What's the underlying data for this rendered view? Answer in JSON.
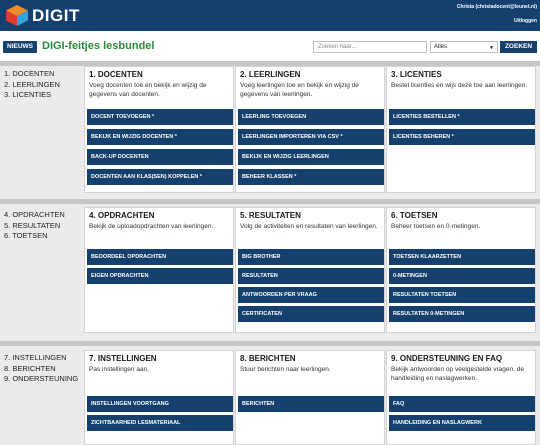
{
  "header": {
    "brand": "DIGIT",
    "user": "Christa (christadocent@leunet.nl)",
    "logout": "Uitloggen"
  },
  "nav": {
    "news_button": "NIEUWS",
    "title": "DIGI-feitjes lesbundel",
    "search_placeholder": "Zoeken naar...",
    "search_filter": "Alles",
    "search_button": "ZOEKEN"
  },
  "colors": {
    "primary": "#15406e",
    "title_green": "#2b8a3e",
    "band_bg": "#ebebeb",
    "separator": "#c6c6c6"
  },
  "sections": [
    {
      "list": [
        "1. DOCENTEN",
        "2. LEERLINGEN",
        "3. LICENTIES"
      ],
      "cards": [
        {
          "title": "1. DOCENTEN",
          "desc": "Voeg docenten toe en bekijk en wijzig de gegevens van docenten.",
          "buttons": [
            "DOCENT TOEVOEGEN *",
            "BEKIJK EN WIJZIG DOCENTEN *",
            "BACK-UP DOCENTEN",
            "DOCENTEN AAN KLAS(SEN) KOPPELEN *"
          ]
        },
        {
          "title": "2. LEERLINGEN",
          "desc": "Voeg leerlingen toe en bekijk en wijzig de gegevens van leerlingen.",
          "buttons": [
            "LEERLING TOEVOEGEN",
            "LEERLINGEN IMPORTEREN VIA CSV *",
            "BEKIJK EN WIJZIG LEERLINGEN",
            "BEHEER KLASSEN *"
          ]
        },
        {
          "title": "3. LICENTIES",
          "desc": "Bestel licenties en wijs deze toe aan leerlingen.",
          "buttons": [
            "LICENTIES BESTELLEN *",
            "LICENTIES BEHEREN *"
          ]
        }
      ]
    },
    {
      "list": [
        "4. OPDRACHTEN",
        "5. RESULTATEN",
        "6. TOETSEN"
      ],
      "cards": [
        {
          "title": "4. OPDRACHTEN",
          "desc": "Bekijk de uploadopdrachten van leerlingen.",
          "buttons": [
            "BEOORDEEL OPDRACHTEN",
            "EIGEN OPDRACHTEN"
          ]
        },
        {
          "title": "5. RESULTATEN",
          "desc": "Volg de activiteiten en resultaten van leerlingen.",
          "buttons": [
            "BIG BROTHER",
            "RESULTATEN",
            "ANTWOORDEN PER VRAAG",
            "CERTIFICATEN"
          ]
        },
        {
          "title": "6. TOETSEN",
          "desc": "Beheer toetsen en 0-metingen.",
          "buttons": [
            "TOETSEN KLAARZETTEN",
            "0-METINGEN",
            "RESULTATEN TOETSEN",
            "RESULTATEN 0-METINGEN"
          ]
        }
      ]
    },
    {
      "list": [
        "7. INSTELLINGEN",
        "8. BERICHTEN",
        "9. ONDERSTEUNING"
      ],
      "cards": [
        {
          "title": "7. INSTELLINGEN",
          "desc": "Pas instellingen aan.",
          "buttons": [
            "INSTELLINGEN VOORTGANG",
            "ZICHTBAARHEID LESMATERIAAL"
          ]
        },
        {
          "title": "8. BERICHTEN",
          "desc": "Stuur berichten naar leerlingen.",
          "buttons": [
            "BERICHTEN"
          ]
        },
        {
          "title": "9. ONDERSTEUNING EN FAQ",
          "desc": "Bekijk antwoorden op veelgestelde vragen, de handleiding en naslagwerken.",
          "buttons": [
            "FAQ",
            "HANDLEIDING EN NASLAGWERK"
          ]
        }
      ]
    }
  ]
}
